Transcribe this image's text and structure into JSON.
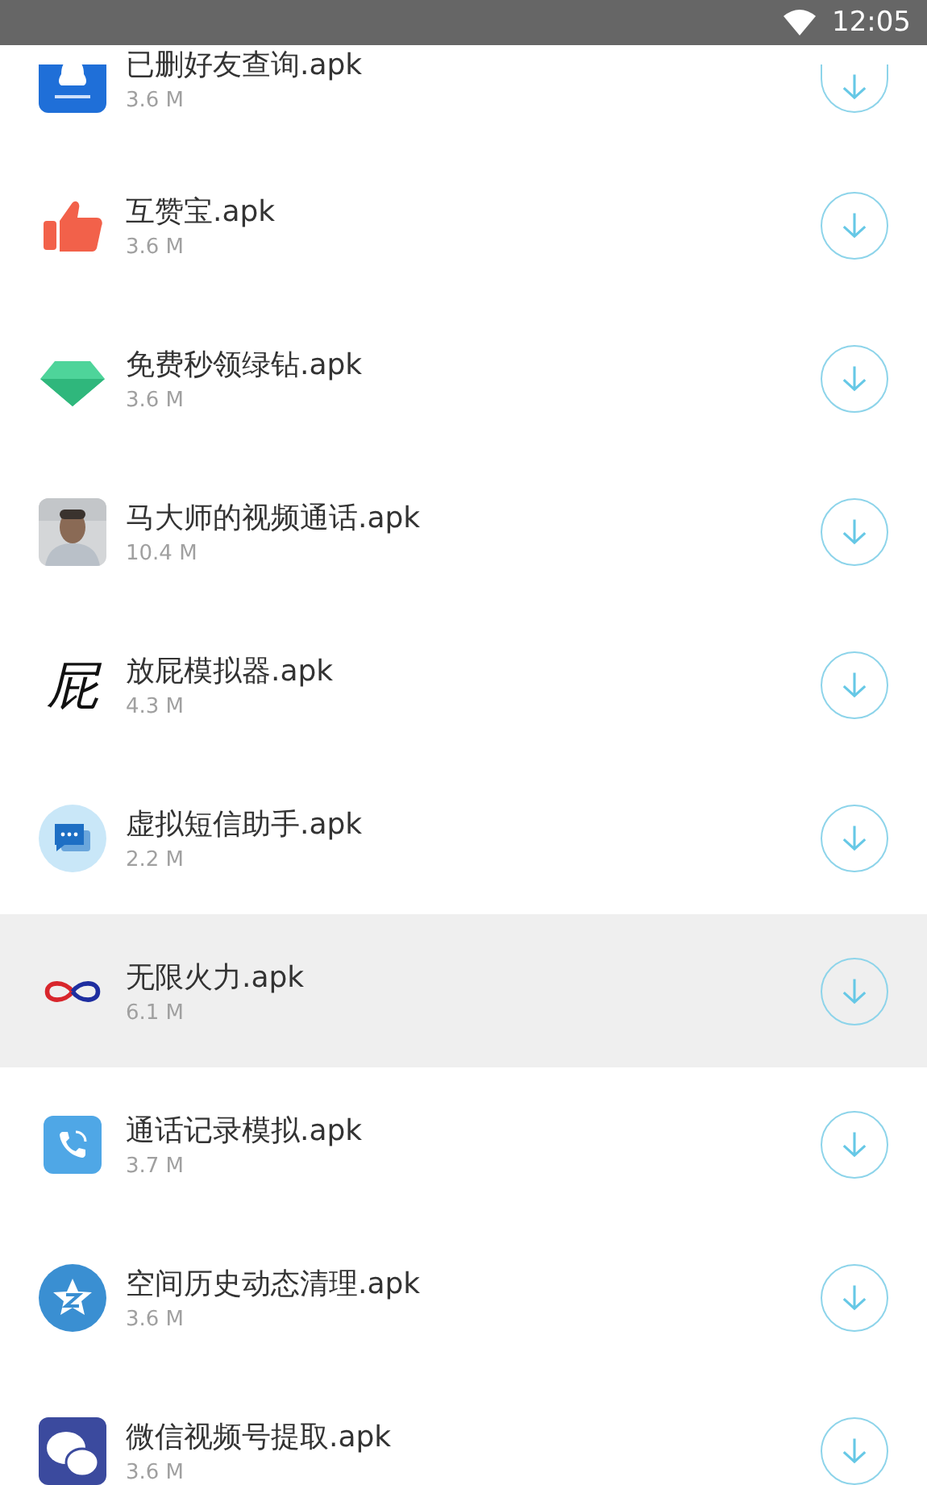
{
  "status_bar": {
    "time": "12:05"
  },
  "files": [
    {
      "name": "已删好友查询.apk",
      "size": "3.6 M",
      "kind": "penguin-square",
      "selected": false
    },
    {
      "name": "互赞宝.apk",
      "size": "3.6 M",
      "kind": "thumb",
      "selected": false
    },
    {
      "name": "免费秒领绿钻.apk",
      "size": "3.6 M",
      "kind": "gem",
      "selected": false
    },
    {
      "name": "马大师的视频通话.apk",
      "size": "10.4 M",
      "kind": "picture",
      "selected": false
    },
    {
      "name": "放屁模拟器.apk",
      "size": "4.3 M",
      "kind": "glyph",
      "glyph": "屁",
      "selected": false
    },
    {
      "name": "虚拟短信助手.apk",
      "size": "2.2 M",
      "kind": "chat-circle",
      "selected": false
    },
    {
      "name": "无限火力.apk",
      "size": "6.1 M",
      "kind": "infinity",
      "selected": true
    },
    {
      "name": "通话记录模拟.apk",
      "size": "3.7 M",
      "kind": "phone-square",
      "selected": false
    },
    {
      "name": "空间历史动态清理.apk",
      "size": "3.6 M",
      "kind": "star-circle",
      "selected": false
    },
    {
      "name": "微信视频号提取.apk",
      "size": "3.6 M",
      "kind": "chat-square",
      "selected": false
    }
  ]
}
